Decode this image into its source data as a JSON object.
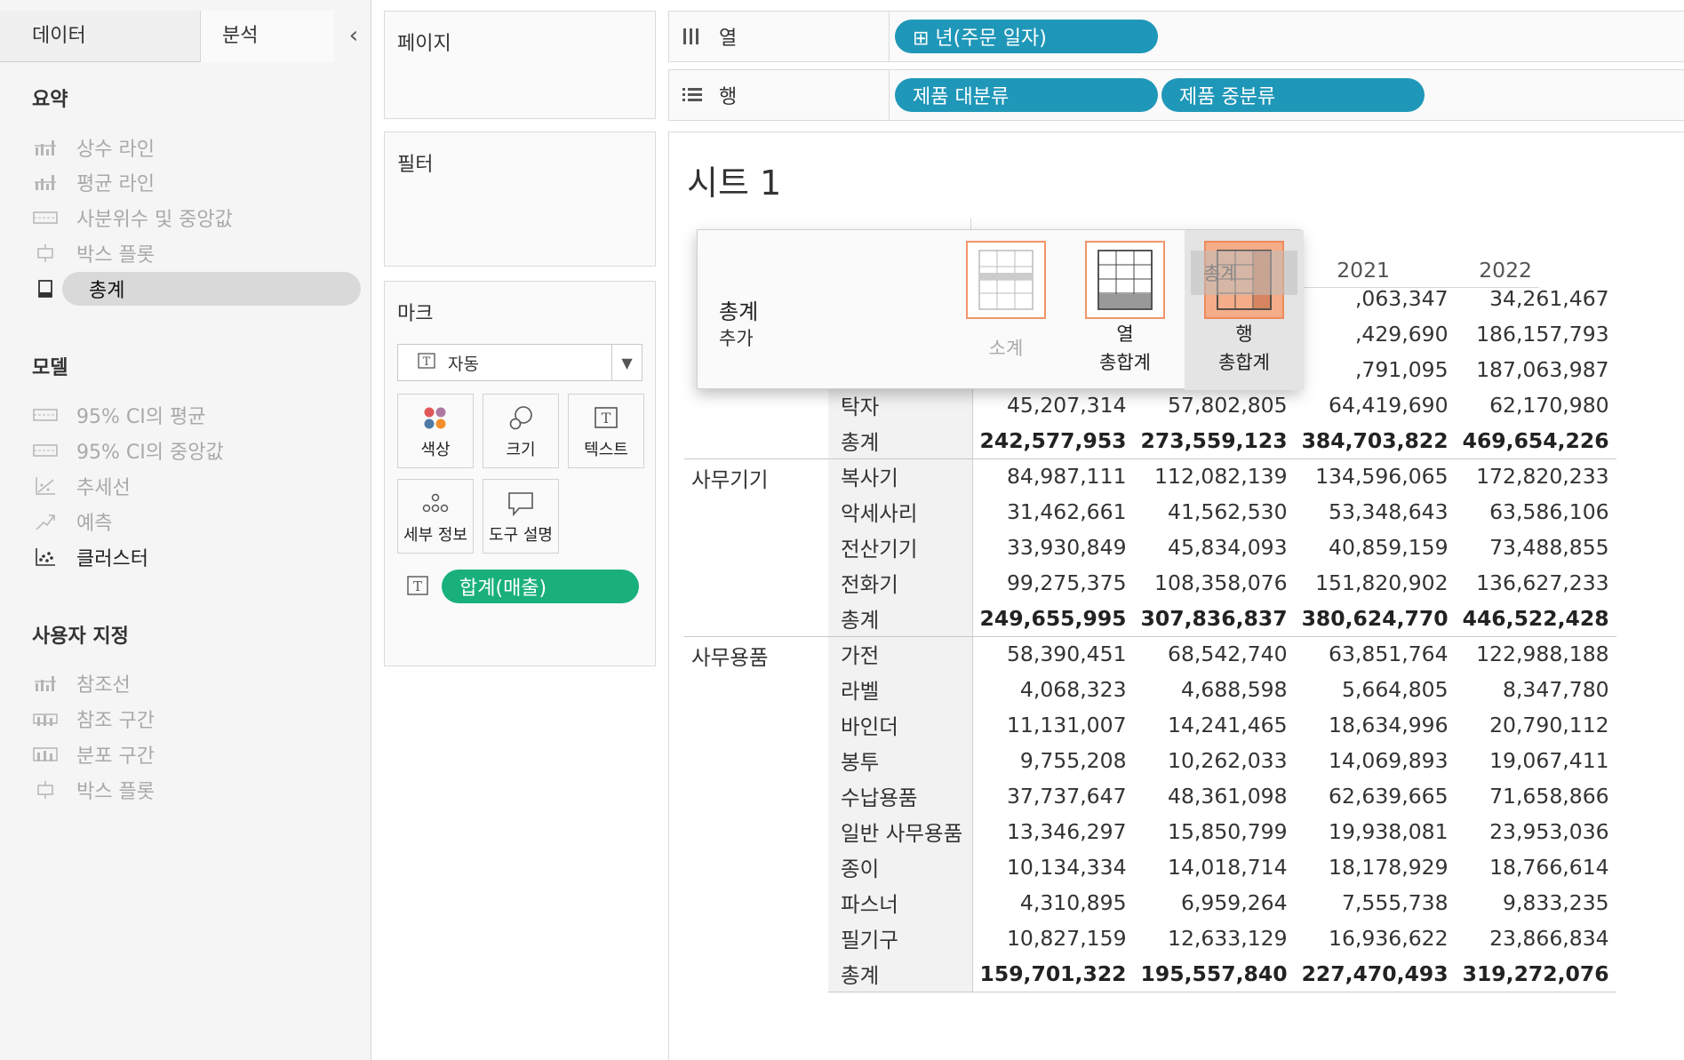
{
  "left_panel": {
    "tabs": {
      "data": "데이터",
      "analysis": "분석"
    },
    "sections": {
      "summary": {
        "title": "요약",
        "items": [
          "상수 라인",
          "평균 라인",
          "사분위수 및 중앙값",
          "박스 플롯",
          "총계"
        ]
      },
      "model": {
        "title": "모델",
        "items": [
          "95% CI의 평균",
          "95% CI의 중앙값",
          "추세선",
          "예측",
          "클러스터"
        ]
      },
      "custom": {
        "title": "사용자 지정",
        "items": [
          "참조선",
          "참조 구간",
          "분포 구간",
          "박스 플롯"
        ]
      }
    }
  },
  "cards": {
    "pages": "페이지",
    "filters": "필터",
    "marks": {
      "title": "마크",
      "type": "자동",
      "buttons": [
        "색상",
        "크기",
        "텍스트",
        "세부 정보",
        "도구 설명"
      ],
      "pill": "합계(매출)"
    }
  },
  "shelves": {
    "columns": {
      "label": "열",
      "pills": [
        "⊞ 년(주문 일자)"
      ]
    },
    "rows": {
      "label": "행",
      "pills": [
        "제품 대분류",
        "제품 중분류"
      ]
    }
  },
  "sheet": {
    "title": "시트 1",
    "visible_headers": [
      "2021",
      "2022"
    ],
    "groups": [
      {
        "category": "",
        "rows": [
          {
            "sub": "",
            "values": [
              "",
              "",
              ",063,347",
              "34,261,467"
            ]
          },
          {
            "sub": "",
            "values": [
              "",
              "",
              ",429,690",
              "186,157,793"
            ]
          },
          {
            "sub": "",
            "values": [
              "",
              "",
              ",791,095",
              "187,063,987"
            ]
          },
          {
            "sub": "탁자",
            "values": [
              "45,207,314",
              "57,802,805",
              "64,419,690",
              "62,170,980"
            ]
          },
          {
            "sub": "총계",
            "total": true,
            "values": [
              "242,577,953",
              "273,559,123",
              "384,703,822",
              "469,654,226"
            ]
          }
        ]
      },
      {
        "category": "사무기기",
        "rows": [
          {
            "sub": "복사기",
            "values": [
              "84,987,111",
              "112,082,139",
              "134,596,065",
              "172,820,233"
            ]
          },
          {
            "sub": "악세사리",
            "values": [
              "31,462,661",
              "41,562,530",
              "53,348,643",
              "63,586,106"
            ]
          },
          {
            "sub": "전산기기",
            "values": [
              "33,930,849",
              "45,834,093",
              "40,859,159",
              "73,488,855"
            ]
          },
          {
            "sub": "전화기",
            "values": [
              "99,275,375",
              "108,358,076",
              "151,820,902",
              "136,627,233"
            ]
          },
          {
            "sub": "총계",
            "total": true,
            "values": [
              "249,655,995",
              "307,836,837",
              "380,624,770",
              "446,522,428"
            ]
          }
        ]
      },
      {
        "category": "사무용품",
        "rows": [
          {
            "sub": "가전",
            "values": [
              "58,390,451",
              "68,542,740",
              "63,851,764",
              "122,988,188"
            ]
          },
          {
            "sub": "라벨",
            "values": [
              "4,068,323",
              "4,688,598",
              "5,664,805",
              "8,347,780"
            ]
          },
          {
            "sub": "바인더",
            "values": [
              "11,131,007",
              "14,241,465",
              "18,634,996",
              "20,790,112"
            ]
          },
          {
            "sub": "봉투",
            "values": [
              "9,755,208",
              "10,262,033",
              "14,069,893",
              "19,067,411"
            ]
          },
          {
            "sub": "수납용품",
            "values": [
              "37,737,647",
              "48,361,098",
              "62,639,665",
              "71,658,866"
            ]
          },
          {
            "sub": "일반 사무용품",
            "values": [
              "13,346,297",
              "15,850,799",
              "19,938,081",
              "23,953,036"
            ]
          },
          {
            "sub": "종이",
            "values": [
              "10,134,334",
              "14,018,714",
              "18,178,929",
              "18,766,614"
            ]
          },
          {
            "sub": "파스너",
            "values": [
              "4,310,895",
              "6,959,264",
              "7,555,738",
              "9,833,235"
            ]
          },
          {
            "sub": "필기구",
            "values": [
              "10,827,159",
              "12,633,129",
              "16,936,622",
              "23,866,834"
            ]
          },
          {
            "sub": "총계",
            "total": true,
            "values": [
              "159,701,322",
              "195,557,840",
              "227,470,493",
              "319,272,076"
            ]
          }
        ]
      }
    ]
  },
  "popup": {
    "title": "총계",
    "subtitle": "추가",
    "options": [
      {
        "label1": "소계",
        "label2": ""
      },
      {
        "label1": "열",
        "label2": "총합계"
      },
      {
        "label1": "행",
        "label2": "총합계"
      }
    ],
    "drag_ghost": "총계"
  },
  "colors": {
    "pill_blue": "#1f97b8",
    "pill_green": "#19b07b",
    "popup_accent": "#f0956a"
  }
}
